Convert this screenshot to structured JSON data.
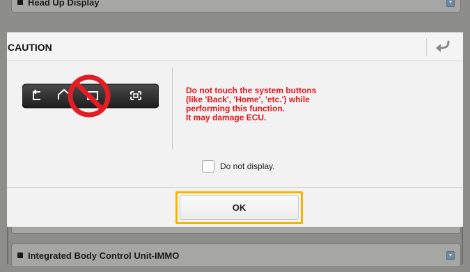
{
  "background_list": {
    "top_item_label": "Head Up Display",
    "bottom_item_label": "Integrated Body Control Unit-IMMO"
  },
  "dialog": {
    "title": "CAUTION",
    "warning_lines": [
      "Do not touch the system buttons",
      "(like 'Back', 'Home', 'etc.') while",
      "performing this function.",
      "It may damage ECU."
    ],
    "checkbox_label": "Do not display.",
    "checkbox_checked": false,
    "ok_label": "OK"
  },
  "colors": {
    "warning_text": "#e5141b",
    "ok_highlight": "#f6b400"
  },
  "icons": {
    "back": "return-arrow-icon",
    "nav_bar": "system-nav-buttons-icon",
    "prohibited": "no-symbol-icon",
    "download": "download-icon"
  }
}
